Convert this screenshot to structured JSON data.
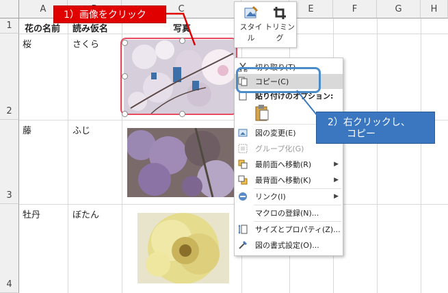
{
  "columns": [
    "A",
    "B",
    "C",
    "D",
    "E",
    "F",
    "G",
    "H"
  ],
  "rows": [
    "1",
    "2",
    "3",
    "4"
  ],
  "cells": {
    "a1": "花の名前",
    "b1": "読み仮名",
    "c1": "写真",
    "a2": "桜",
    "b2": "さくら",
    "a3": "藤",
    "b3": "ふじ",
    "a4": "牡丹",
    "b4": "ぼたん"
  },
  "callouts": {
    "step1": "1）画像をクリック",
    "step2_line1": "2）右クリックし、",
    "step2_line2": "コピー"
  },
  "mini_toolbar": {
    "style_label_1": "スタイ",
    "style_label_2": "ル",
    "trim_label": "トリミング"
  },
  "context_menu": {
    "cut": "切り取り(T)",
    "copy": "コピー(C)",
    "paste_options": "貼り付けのオプション:",
    "change_picture": "図の変更(E)",
    "group": "グループ化(G)",
    "bring_front": "最前面へ移動(R)",
    "send_back": "最背面へ移動(K)",
    "link": "リンク(I)",
    "assign_macro": "マクロの登録(N)...",
    "size_properties": "サイズとプロパティ(Z)...",
    "format_picture": "図の書式設定(O)..."
  },
  "colors": {
    "callout_red": "#e00000",
    "callout_blue": "#3b77c0",
    "selection_red": "#e84a5f",
    "highlight_blue": "#4a8cc9"
  },
  "icons": [
    "cut-icon",
    "copy-icon",
    "paste-icon",
    "change-picture-icon",
    "group-icon",
    "bring-front-icon",
    "send-back-icon",
    "link-icon",
    "size-properties-icon",
    "format-picture-icon",
    "style-icon",
    "crop-icon"
  ]
}
